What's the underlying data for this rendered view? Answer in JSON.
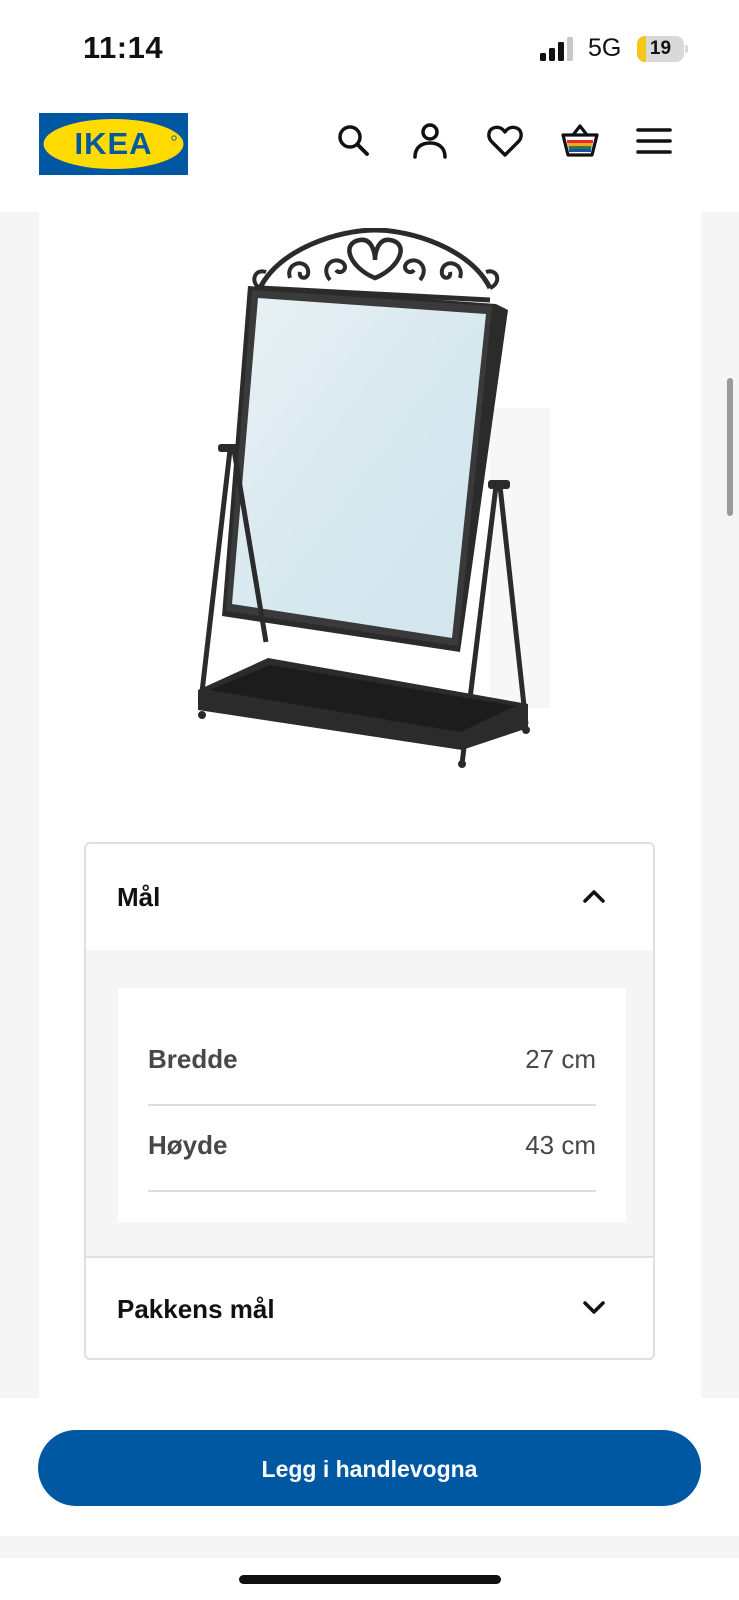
{
  "status_bar": {
    "time": "11:14",
    "network": "5G",
    "battery_percent": "19",
    "battery_level": 0.19,
    "signal_icon": "cellular-signal-icon"
  },
  "header": {
    "logo_text": "IKEA",
    "brand_colors": {
      "blue": "#0058a3",
      "yellow": "#ffdb00"
    },
    "icons": [
      "search-icon",
      "user-icon",
      "heart-icon",
      "basket-icon",
      "menu-icon"
    ]
  },
  "product": {
    "image_icon": "table-mirror-image"
  },
  "dimensions": {
    "title": "Mål",
    "expanded": true,
    "rows": [
      {
        "label": "Bredde",
        "value": "27 cm"
      },
      {
        "label": "Høyde",
        "value": "43 cm"
      }
    ]
  },
  "package": {
    "title": "Pakkens mål",
    "expanded": false
  },
  "cta": {
    "label": "Legg i handlevogna",
    "color": "#0058a3"
  }
}
